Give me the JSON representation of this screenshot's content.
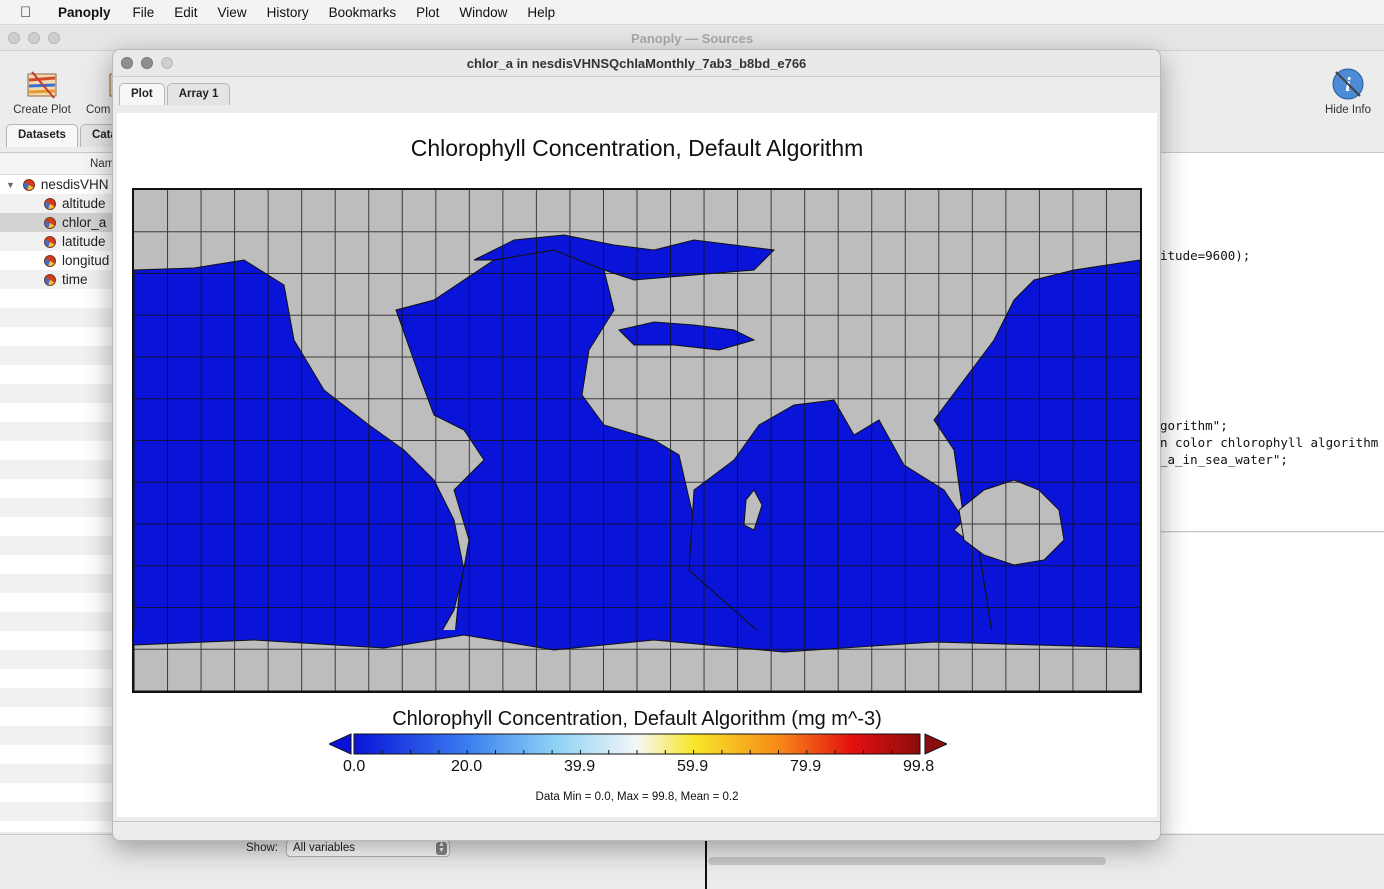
{
  "menubar": {
    "app_name": "Panoply",
    "items": [
      "File",
      "Edit",
      "View",
      "History",
      "Bookmarks",
      "Plot",
      "Window",
      "Help"
    ]
  },
  "sources_window": {
    "title": "Panoply — Sources",
    "toolbar": {
      "create_plot": "Create Plot",
      "combine": "Com",
      "hide_info": "Hide Info"
    },
    "tabs": [
      "Datasets",
      "Cata"
    ],
    "column_header": "Nam",
    "tree": [
      {
        "label": "nesdisVHN",
        "level": 0,
        "selected": false
      },
      {
        "label": "altitude",
        "level": 1,
        "selected": false
      },
      {
        "label": "chlor_a",
        "level": 1,
        "selected": true
      },
      {
        "label": "latitude",
        "level": 1,
        "selected": false
      },
      {
        "label": "longitud",
        "level": 1,
        "selected": false
      },
      {
        "label": "time",
        "level": 1,
        "selected": false
      }
    ],
    "info_lines": [
      {
        "text": "itude=9600);"
      },
      {
        "text": "gorithm\";"
      },
      {
        "text": "n color chlorophyll algorithm"
      },
      {
        "text": "_a_in_sea_water\";"
      }
    ],
    "show_label": "Show:",
    "show_value": "All variables"
  },
  "plot_window": {
    "title": "chlor_a in nesdisVHNSQchlaMonthly_7ab3_b8bd_e766",
    "tabs": [
      "Plot",
      "Array 1"
    ],
    "plot_title": "Chlorophyll Concentration, Default Algorithm",
    "colorbar_title": "Chlorophyll Concentration, Default Algorithm (mg m^-3)",
    "colorbar_ticks": [
      "0.0",
      "20.0",
      "39.9",
      "59.9",
      "79.9",
      "99.8"
    ],
    "stats": "Data Min = 0.0, Max = 99.8, Mean = 0.2",
    "colors": {
      "ocean": "#0a14d8",
      "land": "#bdbdbd",
      "grid": "#111111"
    }
  }
}
